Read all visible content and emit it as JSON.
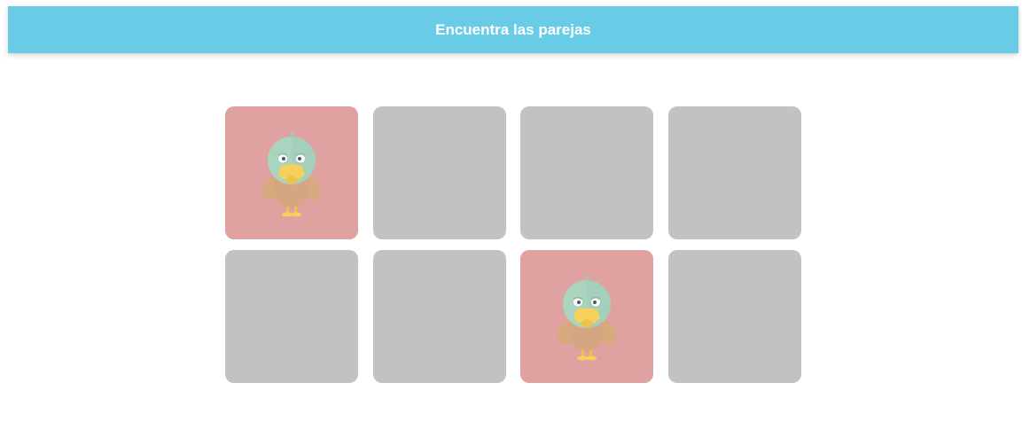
{
  "header": {
    "title": "Encuentra las parejas"
  },
  "board": {
    "cards": [
      {
        "state": "revealed",
        "icon": "duck-icon"
      },
      {
        "state": "hidden"
      },
      {
        "state": "hidden"
      },
      {
        "state": "hidden"
      },
      {
        "state": "hidden"
      },
      {
        "state": "hidden"
      },
      {
        "state": "revealed",
        "icon": "duck-icon"
      },
      {
        "state": "hidden"
      }
    ]
  },
  "colors": {
    "header_bg": "#69cbe6",
    "card_hidden": "#c2c2c2",
    "card_revealed": "#e0a1a1"
  }
}
